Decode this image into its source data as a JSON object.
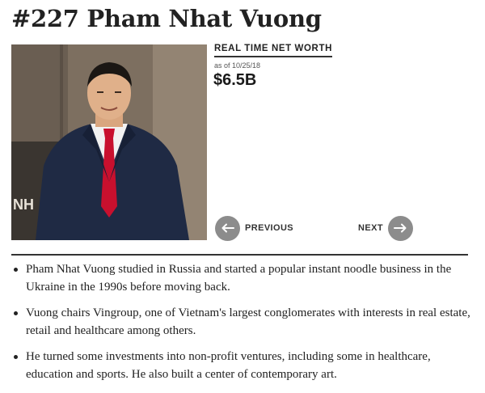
{
  "profile": {
    "title": "#227 Pham Nhat Vuong",
    "photo_alt": "Portrait of Pham Nhat Vuong",
    "photo_sign_text": "NH"
  },
  "net_worth": {
    "label": "REAL TIME NET WORTH",
    "as_of": "as of 10/25/18",
    "value": "$6.5B"
  },
  "navigation": {
    "previous_label": "PREVIOUS",
    "next_label": "NEXT"
  },
  "bullets": [
    "Pham Nhat Vuong studied in Russia and started a popular instant noodle business in the Ukraine in the 1990s before moving back.",
    "Vuong chairs Vingroup, one of Vietnam's largest conglomerates with interests in real estate, retail and healthcare among others.",
    "He turned some investments into non-profit ventures, including some in healthcare, education and sports. He also built a center of contemporary art."
  ],
  "colors": {
    "nav_circle": "#8c8c8c",
    "tie": "#c8102e",
    "suit": "#1f2a44"
  }
}
